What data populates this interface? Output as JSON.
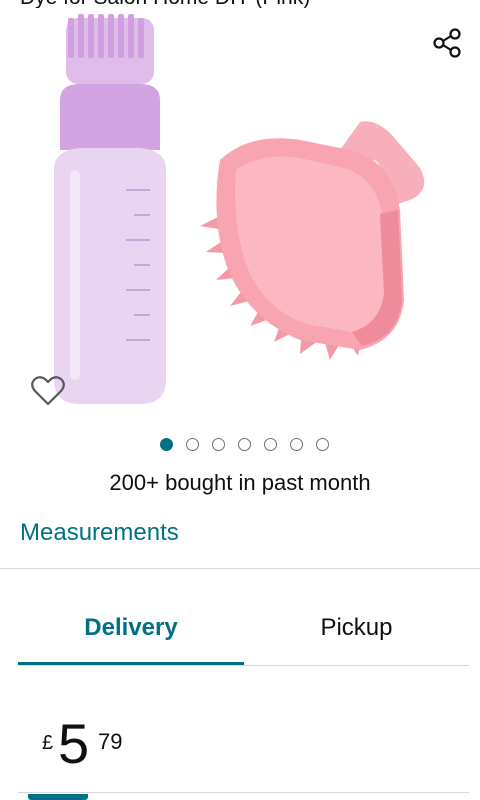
{
  "product": {
    "title_fragment": "Dye for Salon Home DIY (Pink)"
  },
  "gallery": {
    "image_count": 7,
    "active_index": 0,
    "colors": {
      "bottle": "#e6cdef",
      "bottle_top": "#d6a7e3",
      "brush": "#f6a0ac",
      "brush_dark": "#ee8394"
    }
  },
  "social_proof": "200+ bought in past month",
  "links": {
    "measurements": "Measurements"
  },
  "tabs": [
    {
      "label": "Delivery",
      "selected": true
    },
    {
      "label": "Pickup",
      "selected": false
    }
  ],
  "price": {
    "currency": "£",
    "whole": "5",
    "fraction": "79"
  },
  "theme": {
    "accent": "#007185",
    "text": "#0f1111",
    "divider": "#d5d9d9"
  }
}
